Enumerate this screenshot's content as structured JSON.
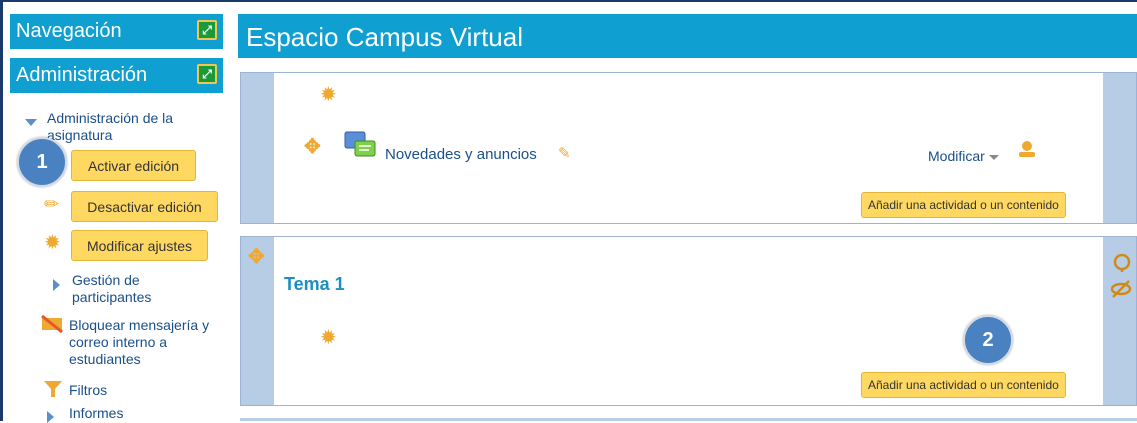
{
  "sidebar": {
    "navigation_title": "Navegación",
    "administration_title": "Administración",
    "course_admin_label": "Administración de la asignatura",
    "activate_editing": "Activar edición",
    "deactivate_editing": "Desactivar edición",
    "modify_settings": "Modificar ajustes",
    "participants_label": "Gestión de participantes",
    "block_messaging_label": "Bloquear mensajería y correo interno a estudiantes",
    "filters_label": "Filtros",
    "reports_label": "Informes"
  },
  "main": {
    "course_title": "Espacio Campus Virtual",
    "section0": {
      "forum_link": "Novedades y anuncios",
      "modify_menu": "Modificar",
      "add_activity": "Añadir una actividad o un contenido"
    },
    "section1": {
      "title": "Tema 1",
      "add_activity": "Añadir una actividad o un contenido"
    }
  },
  "callouts": {
    "first": "1",
    "second": "2"
  },
  "colors": {
    "header_blue": "#0f9fd0",
    "button_yellow": "#ffd862",
    "section_panel": "#b7cde6",
    "callout_blue": "#4a82c1"
  }
}
